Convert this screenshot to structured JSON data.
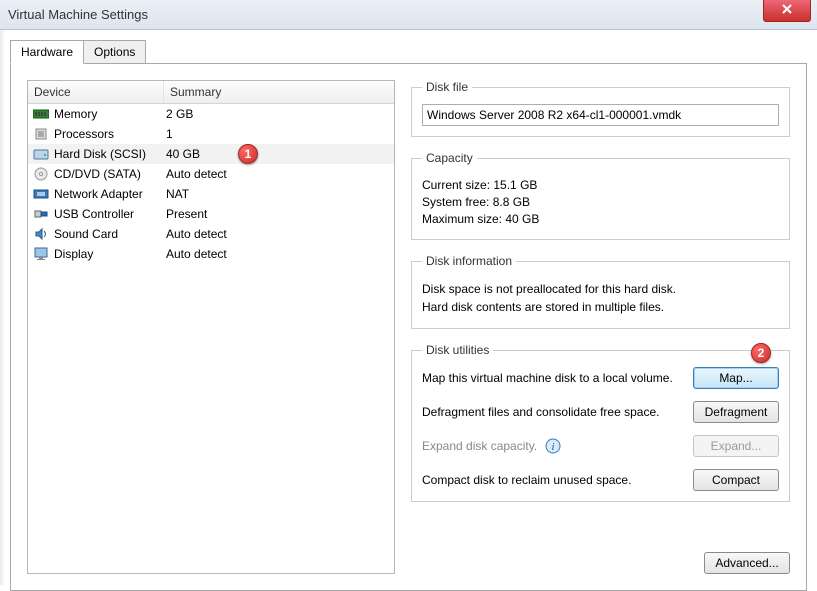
{
  "window": {
    "title": "Virtual Machine Settings"
  },
  "tabs": {
    "hardware": "Hardware",
    "options": "Options"
  },
  "table": {
    "headers": {
      "device": "Device",
      "summary": "Summary"
    },
    "rows": [
      {
        "name": "Memory",
        "summary": "2 GB",
        "icon": "memory"
      },
      {
        "name": "Processors",
        "summary": "1",
        "icon": "cpu"
      },
      {
        "name": "Hard Disk (SCSI)",
        "summary": "40 GB",
        "icon": "hdd",
        "selected": true
      },
      {
        "name": "CD/DVD (SATA)",
        "summary": "Auto detect",
        "icon": "cd"
      },
      {
        "name": "Network Adapter",
        "summary": "NAT",
        "icon": "nic"
      },
      {
        "name": "USB Controller",
        "summary": "Present",
        "icon": "usb"
      },
      {
        "name": "Sound Card",
        "summary": "Auto detect",
        "icon": "sound"
      },
      {
        "name": "Display",
        "summary": "Auto detect",
        "icon": "display"
      }
    ]
  },
  "diskfile": {
    "legend": "Disk file",
    "value": "Windows Server 2008 R2 x64-cl1-000001.vmdk"
  },
  "capacity": {
    "legend": "Capacity",
    "current_label": "Current size:",
    "current_value": "15.1 GB",
    "free_label": "System free:",
    "free_value": "8.8 GB",
    "max_label": "Maximum size:",
    "max_value": "40 GB"
  },
  "diskinfo": {
    "legend": "Disk information",
    "line1": "Disk space is not preallocated for this hard disk.",
    "line2": "Hard disk contents are stored in multiple files."
  },
  "utilities": {
    "legend": "Disk utilities",
    "map_text": "Map this virtual machine disk to a local volume.",
    "map_btn": "Map...",
    "defrag_text": "Defragment files and consolidate free space.",
    "defrag_btn": "Defragment",
    "expand_text": "Expand disk capacity.",
    "expand_btn": "Expand...",
    "compact_text": "Compact disk to reclaim unused space.",
    "compact_btn": "Compact"
  },
  "advanced_btn": "Advanced...",
  "callouts": {
    "one": "1",
    "two": "2"
  }
}
